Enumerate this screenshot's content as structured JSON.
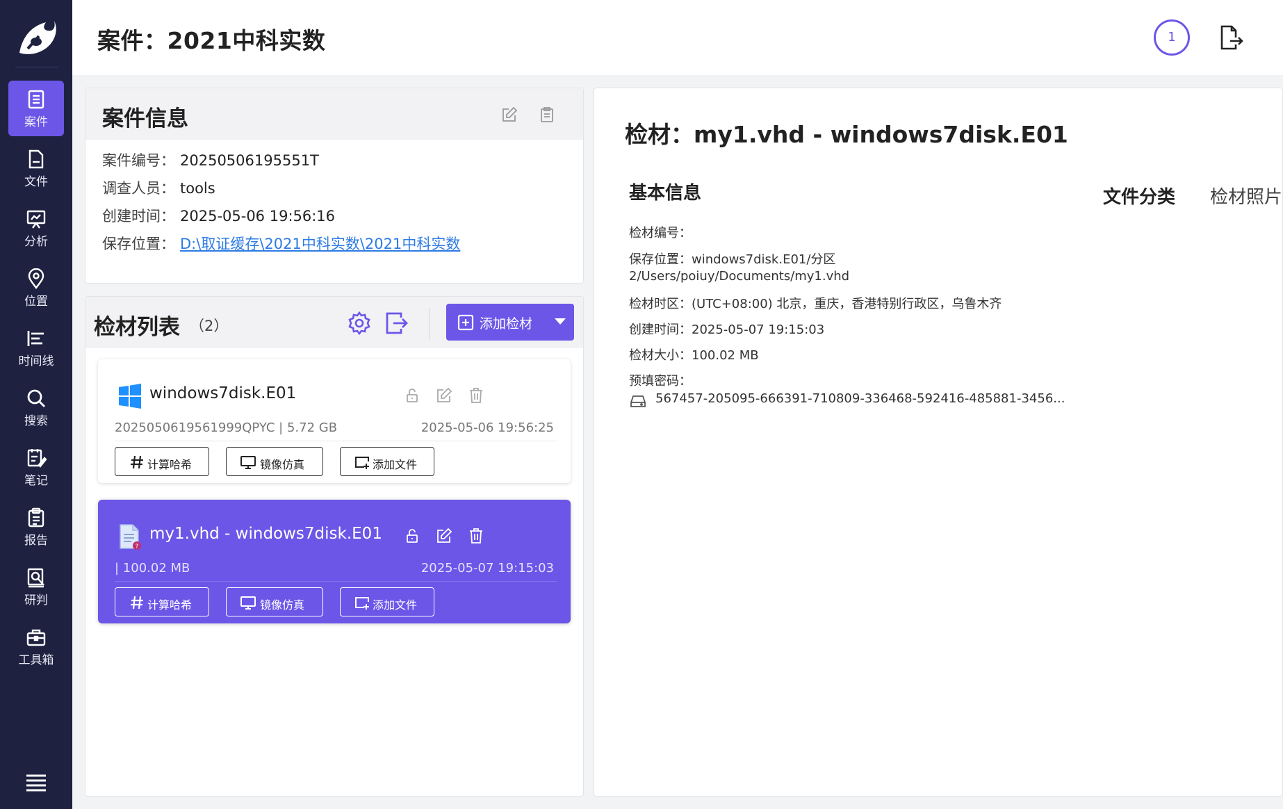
{
  "sidebar": {
    "items": [
      {
        "label": "案件",
        "icon": "case-icon"
      },
      {
        "label": "文件",
        "icon": "file-icon"
      },
      {
        "label": "分析",
        "icon": "analysis-icon"
      },
      {
        "label": "位置",
        "icon": "location-icon"
      },
      {
        "label": "时间线",
        "icon": "timeline-icon"
      },
      {
        "label": "搜索",
        "icon": "search-icon"
      },
      {
        "label": "笔记",
        "icon": "notes-icon"
      },
      {
        "label": "报告",
        "icon": "report-icon"
      },
      {
        "label": "研判",
        "icon": "judgement-icon"
      },
      {
        "label": "工具箱",
        "icon": "toolbox-icon"
      }
    ],
    "active_index": 0
  },
  "header": {
    "title": "案件：2021中科实数",
    "task_count": "1"
  },
  "case_info": {
    "title": "案件信息",
    "rows": [
      {
        "key": "案件编号：",
        "value": "20250506195551T"
      },
      {
        "key": "调查人员：",
        "value": "tools"
      },
      {
        "key": "创建时间：",
        "value": "2025-05-06 19:56:16"
      },
      {
        "key": "保存位置：",
        "value": "D:\\取证缓存\\2021中科实数\\2021中科实数"
      }
    ]
  },
  "evidence_list": {
    "title": "检材列表",
    "count": "（2）",
    "add_button": "添加检材",
    "items": [
      {
        "name": "windows7disk.E01",
        "meta": "2025050619561999QPYC | 5.72 GB",
        "time": "2025-05-06 19:56:25",
        "icon": "windows-icon",
        "buttons": [
          "计算哈希",
          "镜像仿真",
          "添加文件"
        ]
      },
      {
        "name": "my1.vhd - windows7disk.E01",
        "meta": "| 100.02 MB",
        "time": "2025-05-07 19:15:03",
        "icon": "vhd-file-icon",
        "buttons": [
          "计算哈希",
          "镜像仿真",
          "添加文件"
        ]
      }
    ]
  },
  "detail": {
    "title": "检材：my1.vhd - windows7disk.E01",
    "section_title": "基本信息",
    "tabs": [
      "文件分类",
      "检材照片"
    ],
    "rows": [
      "检材编号：",
      "保存位置：windows7disk.E01/分区",
      "2/Users/poiuy/Documents/my1.vhd",
      "检材时区：(UTC+08:00) 北京，重庆，香港特别行政区，乌鲁木齐",
      "创建时间：2025-05-07 19:15:03",
      "检材大小：100.02 MB",
      "预填密码："
    ],
    "password": "567457-205095-666391-710809-336468-592416-485881-3456..."
  },
  "colors": {
    "accent": "#6b56e8",
    "sidebar": "#1e2240",
    "link": "#2d7be5"
  }
}
